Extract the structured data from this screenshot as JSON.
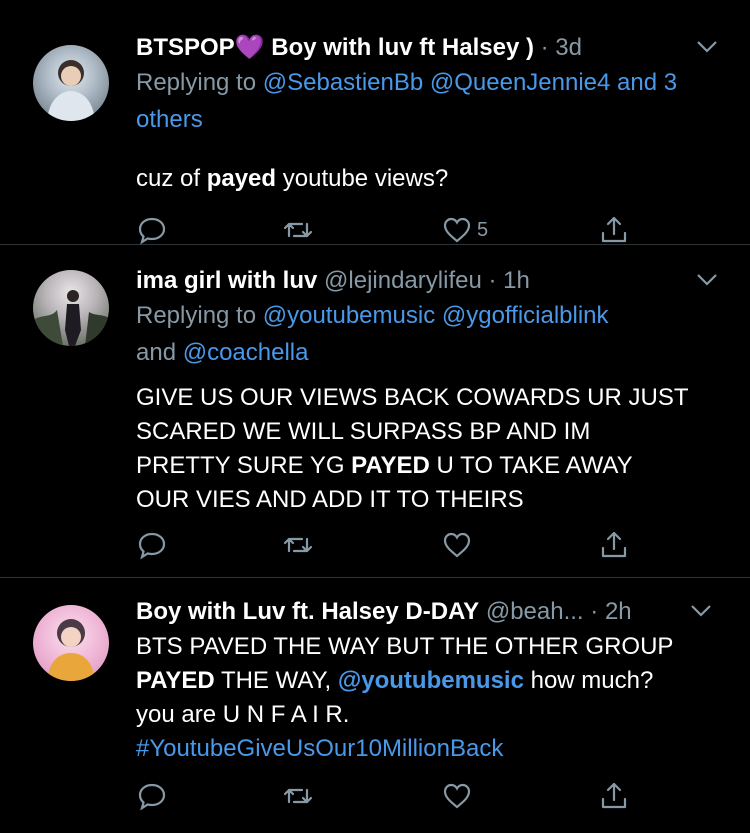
{
  "tweets": [
    {
      "name": "BTSPOP💜 Boy with luv ft Halsey )",
      "handle": "",
      "dot": "·",
      "time": "3d",
      "reply_prefix": "Replying to ",
      "reply_links": "@SebastienBb @QueenJennie4 and 3 others",
      "text_before": "cuz of ",
      "text_bold": "payed",
      "text_after": " youtube views?",
      "likes": "5",
      "avatar_colors": [
        "#c8d4de",
        "#6e7e8a"
      ]
    },
    {
      "name": "ima girl with luv",
      "handle": "@lejindarylifeu",
      "dot": "·",
      "time": "1h",
      "reply_prefix": "Replying to ",
      "reply_links": "@youtubemusic @ygofficialblink",
      "reply_and": "and ",
      "reply_links2": "@coachella",
      "text_line1": "GIVE US OUR VIEWS BACK COWARDS UR JUST",
      "text_line2": "SCARED WE WILL SURPASS BP AND IM",
      "text_line3_before": "PRETTY SURE YG ",
      "text_line3_bold": "PAYED",
      "text_line3_after": " U TO TAKE AWAY",
      "text_line4": "OUR VIES AND ADD IT TO THEIRS",
      "likes": "",
      "avatar_colors": [
        "#d9d6d8",
        "#3d4a3b"
      ]
    },
    {
      "name": "Boy with Luv ft. Halsey D-DAY",
      "handle": "@beah...",
      "dot": "·",
      "time": "2h",
      "text_line1": "BTS PAVED THE WAY BUT THE OTHER GROUP",
      "text_line2_bold": "PAYED",
      "text_line2_mid": " THE WAY, ",
      "text_line2_link": "@youtubemusic",
      "text_line2_after": " how much?",
      "text_line3": "you are U N F A I R.",
      "text_line4_link": "#YoutubeGiveUsOur10MillionBack",
      "likes": "",
      "avatar_colors": [
        "#f0b9d6",
        "#e8a33a"
      ]
    }
  ],
  "colors": {
    "background": "#000000",
    "secondary_text": "#8899a6",
    "link": "#4a99e9",
    "divider": "#2f3336"
  },
  "icons": [
    "reply-icon",
    "retweet-icon",
    "like-icon",
    "share-icon",
    "chevron-down-icon"
  ]
}
